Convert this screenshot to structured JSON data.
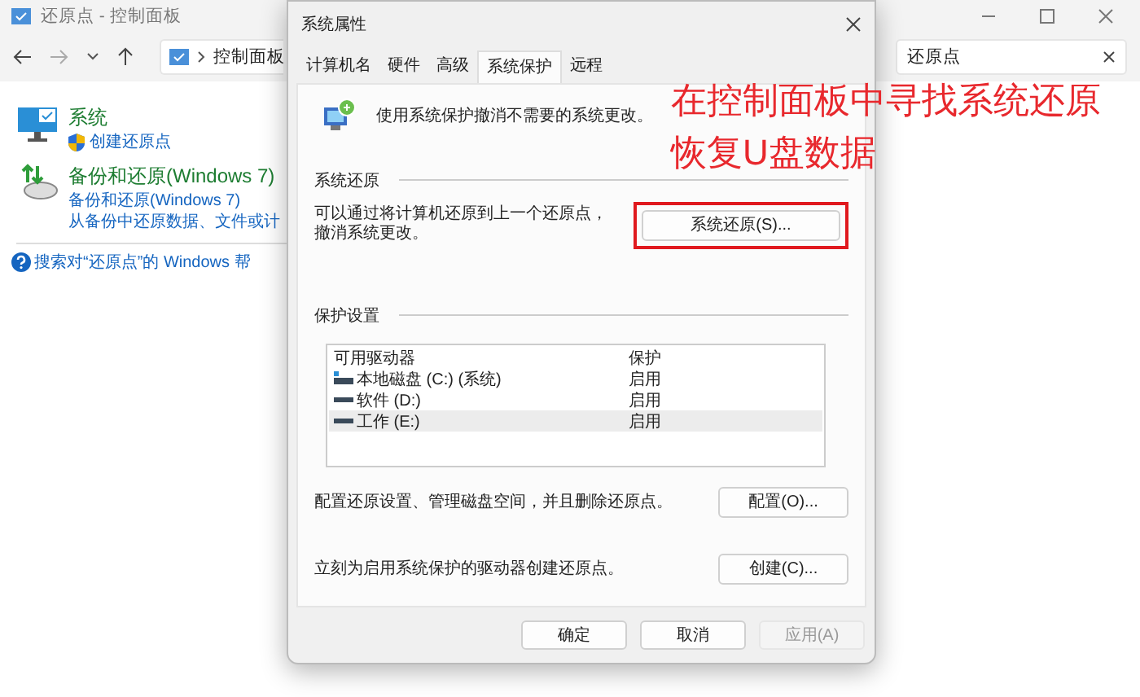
{
  "background_window": {
    "title": "还原点 - 控制面板",
    "breadcrumb": "控制面板",
    "search": {
      "value": "还原点"
    },
    "items": [
      {
        "kind": "system",
        "title": "系统",
        "links": [
          {
            "text": "创建还原点",
            "shield": true
          }
        ]
      },
      {
        "kind": "backup",
        "title": "备份和还原(Windows 7)",
        "links": [
          {
            "text": "备份和还原(Windows 7)",
            "shield": false
          },
          {
            "text": "从备份中还原数据、文件或计",
            "shield": false
          }
        ]
      }
    ],
    "help_link": "搜索对“还原点”的 Windows 帮"
  },
  "dialog": {
    "title": "系统属性",
    "tabs": [
      {
        "label": "计算机名",
        "selected": false
      },
      {
        "label": "硬件",
        "selected": false
      },
      {
        "label": "高级",
        "selected": false
      },
      {
        "label": "系统保护",
        "selected": true
      },
      {
        "label": "远程",
        "selected": false
      }
    ],
    "intro": "使用系统保护撤消不需要的系统更改。",
    "restore": {
      "heading": "系统还原",
      "text": "可以通过将计算机还原到上一个还原点，撤消系统更改。",
      "button": "系统还原(S)...",
      "highlighted": true
    },
    "protection": {
      "heading": "保护设置",
      "columns": [
        "可用驱动器",
        "保护"
      ],
      "rows": [
        {
          "kind": "system",
          "drive": "本地磁盘 (C:) (系统)",
          "status": "启用",
          "selected": false
        },
        {
          "kind": "drive",
          "drive": "软件 (D:)",
          "status": "启用",
          "selected": false
        },
        {
          "kind": "drive",
          "drive": "工作 (E:)",
          "status": "启用",
          "selected": true
        }
      ]
    },
    "configure": {
      "text": "配置还原设置、管理磁盘空间，并且删除还原点。",
      "button": "配置(O)..."
    },
    "create": {
      "text": "立刻为启用系统保护的驱动器创建还原点。",
      "button": "创建(C)..."
    },
    "buttons": [
      {
        "label": "确定",
        "disabled": false
      },
      {
        "label": "取消",
        "disabled": false
      },
      {
        "label": "应用(A)",
        "disabled": true
      }
    ]
  },
  "annotation": {
    "lines": [
      "在控制面板中寻找系统还原",
      "恢复U盘数据"
    ]
  }
}
